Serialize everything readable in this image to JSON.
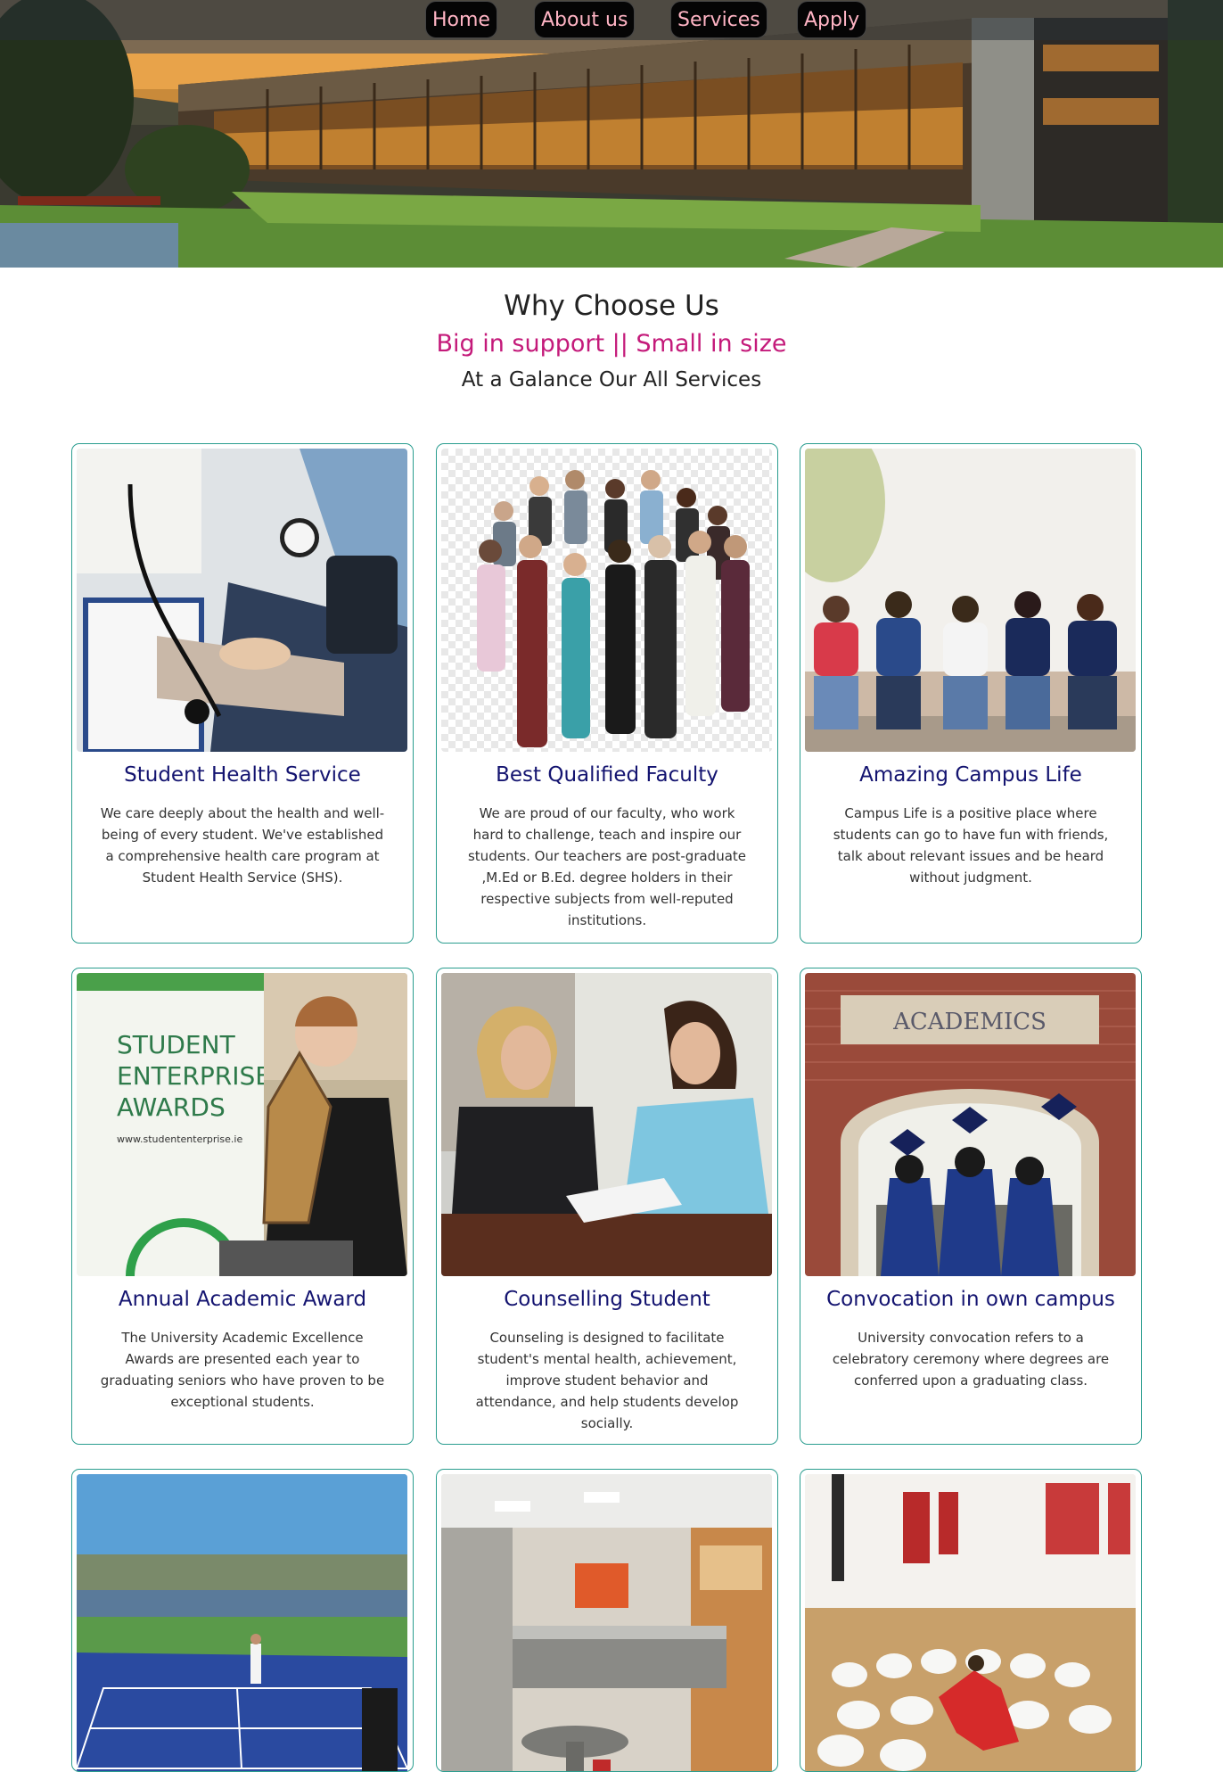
{
  "nav": {
    "items": [
      {
        "label": "Home"
      },
      {
        "label": "About us"
      },
      {
        "label": "Services"
      },
      {
        "label": "Apply"
      }
    ]
  },
  "intro": {
    "title": "Why Choose Us",
    "subtitle": "Big in support || Small in size",
    "tagline": "At a Galance Our All Services"
  },
  "cards": [
    {
      "title": "Student Health Service",
      "description": "We care deeply about the health and well-being of every student. We've established a comprehensive health care program at Student Health Service (SHS)."
    },
    {
      "title": "Best Qualified Faculty",
      "description": "We are proud of our faculty, who work hard to challenge, teach and inspire our students. Our teachers are post-graduate ,M.Ed or B.Ed. degree holders in their respective subjects from well-reputed institutions."
    },
    {
      "title": "Amazing Campus Life",
      "description": "Campus Life is a positive place where students can go to have fun with friends, talk about relevant issues and be heard without judgment."
    },
    {
      "title": "Annual Academic Award",
      "description": "The University Academic Excellence Awards are presented each year to graduating seniors who have proven to be exceptional students."
    },
    {
      "title": "Counselling Student",
      "description": "Counseling is designed to facilitate student's mental health, achievement, improve student behavior and attendance, and help students develop socially."
    },
    {
      "title": "Convocation in own campus",
      "description": "University convocation refers to a celebratory ceremony where degrees are conferred upon a graduating class."
    },
    {
      "title": "",
      "description": ""
    },
    {
      "title": "",
      "description": ""
    },
    {
      "title": "",
      "description": ""
    }
  ],
  "images": {
    "award_sign": [
      "STUDENT",
      "ENTERPRISE",
      "AWARDS",
      "www.studententerprise.ie"
    ],
    "academics_sign": "ACADEMICS"
  },
  "colors": {
    "accent_pink": "#c41a7a",
    "card_title": "#141470",
    "card_border": "#2a9d8f",
    "nav_text": "#ffb4c4"
  }
}
